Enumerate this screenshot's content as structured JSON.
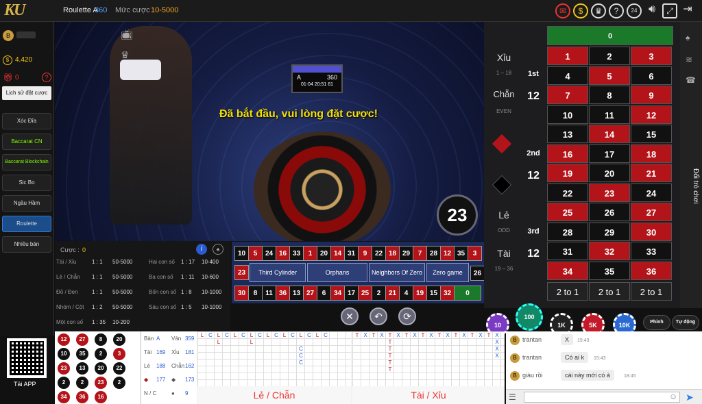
{
  "header": {
    "logo": "KU",
    "table_name": "Roulette A",
    "table_num": "360",
    "bet_label": "Mức cược :",
    "bet_range": "10-5000"
  },
  "sidebar": {
    "balance": "4.420",
    "gift": "0",
    "history_button": "Lịch sử đặt cược",
    "games": [
      "Xóc Đĩa",
      "Baccarat CN",
      "Baccarat Blockchain",
      "Sic Bo",
      "Ngầu Hầm",
      "Roulette",
      "Nhiều bàn"
    ],
    "app_label": "Tải APP"
  },
  "video": {
    "announce": "Đã bắt đầu, vui lòng đặt cược!",
    "screen_table": "A",
    "screen_num": "360",
    "screen_time": "01-04 20:51 61",
    "result": "23"
  },
  "racetrack": {
    "top": [
      "5",
      "24",
      "16",
      "33",
      "1",
      "20",
      "14",
      "31",
      "9",
      "22",
      "18",
      "29",
      "7",
      "28",
      "12",
      "35",
      "3"
    ],
    "bottom": [
      "30",
      "8",
      "11",
      "36",
      "13",
      "27",
      "6",
      "34",
      "17",
      "25",
      "2",
      "21",
      "4",
      "19",
      "15",
      "32"
    ],
    "left": "10",
    "left2": "23",
    "right": "26",
    "zero": "0",
    "sections": [
      "Third Cylinder",
      "Orphans",
      "Neighbors Of Zero",
      "Zero game"
    ]
  },
  "info": {
    "bet_label": "Cược :",
    "bet_value": "0",
    "rows": [
      {
        "a": "Tài / Xỉu",
        "b": "1 : 1",
        "c": "50-5000",
        "d": "Hai con số",
        "e": "1 : 17",
        "f": "10-400"
      },
      {
        "a": "Lẻ / Chẵn",
        "b": "1 : 1",
        "c": "50-5000",
        "d": "Ba con số",
        "e": "1 : 11",
        "f": "10-600"
      },
      {
        "a": "Đỏ / Đen",
        "b": "1 : 1",
        "c": "50-5000",
        "d": "Bốn con số",
        "e": "1 : 8",
        "f": "10-1000"
      },
      {
        "a": "Nhóm / Cột",
        "b": "1 : 2",
        "c": "50-5000",
        "d": "Sáu con số",
        "e": "1 : 5",
        "f": "10-1000"
      },
      {
        "a": "Một con số",
        "b": "1 : 35",
        "c": "10-200",
        "d": "",
        "e": "",
        "f": ""
      }
    ]
  },
  "board": {
    "zero": "0",
    "side": [
      "Xỉu",
      "1 – 18",
      "Chẵn",
      "EVEN",
      "Lẻ",
      "ODD",
      "Tài",
      "19 – 36"
    ],
    "dozens": [
      "1st",
      "12",
      "2nd",
      "12",
      "3rd",
      "12"
    ],
    "col_bets": [
      "2 to 1",
      "2 to 1",
      "2 to 1"
    ],
    "tab": "Đổi trò chơi"
  },
  "chips": [
    "10",
    "100",
    "1K",
    "5K",
    "10K",
    "Phinh",
    "Tự động"
  ],
  "history": {
    "results": [
      "12",
      "27",
      "8",
      "20",
      "10",
      "35",
      "2",
      "3",
      "23",
      "13",
      "20",
      "22",
      "2",
      "2",
      "23",
      "2",
      "34",
      "36",
      "16"
    ],
    "stats": [
      {
        "k": "Bàn",
        "v": "A",
        "k2": "Ván",
        "v2": "359"
      },
      {
        "k": "Tài",
        "v": "169",
        "k2": "Xỉu",
        "v2": "181"
      },
      {
        "k": "Lẻ",
        "v": "188",
        "k2": "Chẵn",
        "v2": "162"
      },
      {
        "k": "◆",
        "v": "177",
        "k2": "◆",
        "v2": "173"
      },
      {
        "k": "N / C",
        "v": "",
        "k2": "●",
        "v2": "9"
      }
    ],
    "road1_label": "Lẻ / Chẵn",
    "road2_label": "Tài / Xỉu"
  },
  "chat": {
    "messages": [
      {
        "user": "trantan",
        "text": "X",
        "time": "15:43"
      },
      {
        "user": "trantan",
        "text": "Có ai k",
        "time": "15:43"
      },
      {
        "user": "giàu rồi",
        "text": "cái này mới có à",
        "time": "18:45"
      }
    ]
  }
}
